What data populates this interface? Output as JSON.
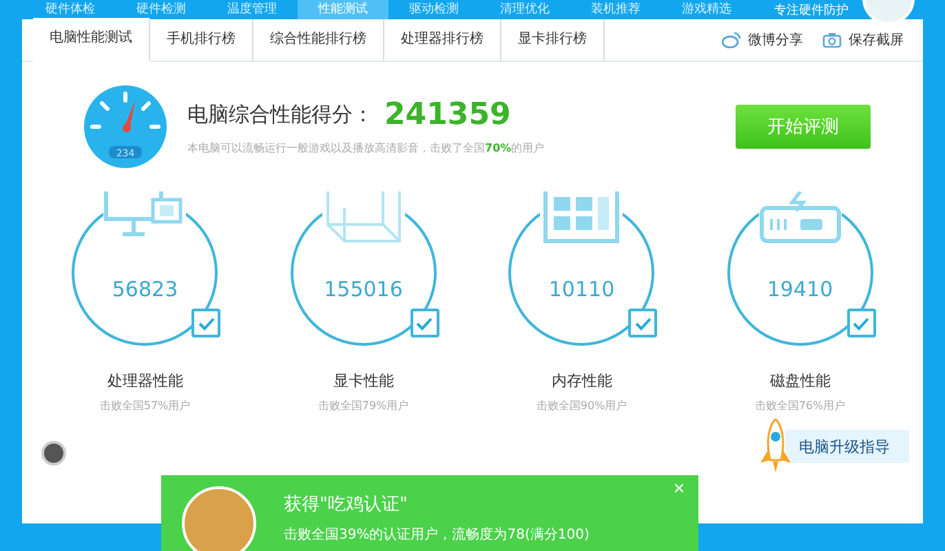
{
  "top_nav": {
    "items": [
      {
        "label": "硬件体检",
        "selected": false
      },
      {
        "label": "硬件检测",
        "selected": false
      },
      {
        "label": "温度管理",
        "selected": false
      },
      {
        "label": "性能测试",
        "selected": true
      },
      {
        "label": "驱动检测",
        "selected": false
      },
      {
        "label": "清理优化",
        "selected": false
      },
      {
        "label": "装机推荐",
        "selected": false
      },
      {
        "label": "游戏精选",
        "selected": false
      }
    ],
    "slogan": "专注硬件防护"
  },
  "sub_tabs": {
    "items": [
      {
        "label": "电脑性能测试",
        "selected": true
      },
      {
        "label": "手机排行榜",
        "selected": false
      },
      {
        "label": "综合性能排行榜",
        "selected": false
      },
      {
        "label": "处理器排行榜",
        "selected": false
      },
      {
        "label": "显卡排行榜",
        "selected": false
      }
    ],
    "actions": [
      {
        "kind": "weibo",
        "label": "微博分享"
      },
      {
        "kind": "camera",
        "label": "保存截屏"
      }
    ]
  },
  "score": {
    "gauge_reading": "234",
    "label": "电脑综合性能得分：",
    "value": "241359",
    "desc_before": "本电脑可以流畅运行一般游戏以及播放高清影音，击败了全国",
    "desc_highlight": "70%",
    "desc_after": "的用户",
    "button": "开始评测"
  },
  "cards": [
    {
      "kind": "cpu",
      "value": "56823",
      "checked": true,
      "title": "处理器性能",
      "note": "击败全国57%用户"
    },
    {
      "kind": "gpu",
      "value": "155016",
      "checked": true,
      "title": "显卡性能",
      "note": "击败全国79%用户"
    },
    {
      "kind": "ram",
      "value": "10110",
      "checked": true,
      "title": "内存性能",
      "note": "击败全国90%用户"
    },
    {
      "kind": "disk",
      "value": "19410",
      "checked": true,
      "title": "磁盘性能",
      "note": "击败全国76%用户"
    }
  ],
  "upgrade_guide": "电脑升级指导",
  "popup": {
    "title": "获得\"吃鸡认证\"",
    "text": "击败全国39%的认证用户，流畅度为78(满分100)",
    "close": "×"
  }
}
